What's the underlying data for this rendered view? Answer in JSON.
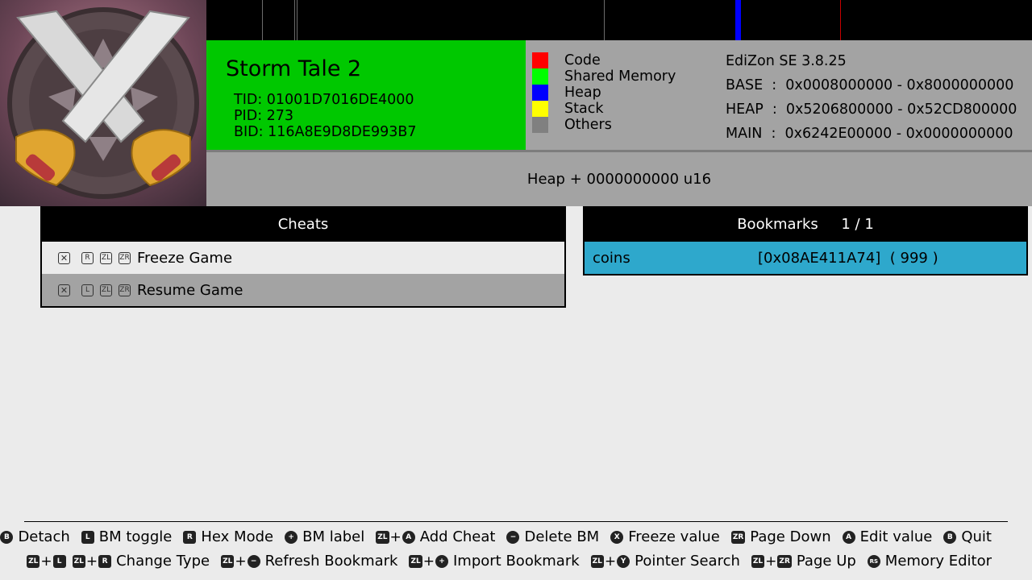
{
  "memory_map": {
    "marks": [
      {
        "color": "#6b6b6b",
        "name": "code-mark"
      },
      {
        "color": "#6b6b6b",
        "name": "code-mark"
      },
      {
        "color": "#6b6b6b",
        "name": "code-mark"
      },
      {
        "color": "#6b6b6b",
        "name": "code-mark"
      },
      {
        "color": "#0000ff",
        "name": "heap-mark"
      },
      {
        "color": "#c80000",
        "name": "code-mark"
      }
    ]
  },
  "game": {
    "title": "Storm Tale 2",
    "tid": "TID: 01001D7016DE4000",
    "pid": "PID: 273",
    "bid": "BID: 116A8E9D8DE993B7"
  },
  "legend": [
    {
      "label": "Code",
      "color": "#ff0000"
    },
    {
      "label": "Shared Memory",
      "color": "#00ff00"
    },
    {
      "label": "Heap",
      "color": "#0000ff"
    },
    {
      "label": "Stack",
      "color": "#ffff00"
    },
    {
      "label": "Others",
      "color": "#808080"
    }
  ],
  "system": {
    "version": "EdiZon SE 3.8.25",
    "base": "BASE  :  0x0008000000 - 0x8000000000",
    "heap": "HEAP  :  0x5206800000 - 0x52CD800000",
    "main": "MAIN  :  0x6242E00000 - 0x0000000000"
  },
  "search": {
    "text": "Heap + 0000000000 u16"
  },
  "cheats": {
    "header": "Cheats",
    "items": [
      {
        "label": "Freeze Game",
        "buttons": [
          "R",
          "ZL",
          "ZR"
        ]
      },
      {
        "label": "Resume Game",
        "buttons": [
          "L",
          "ZL",
          "ZR"
        ]
      }
    ]
  },
  "bookmarks": {
    "header": "Bookmarks     1 / 1",
    "items": [
      {
        "name": "coins",
        "value": "[0x08AE411A74]  ( 999 )"
      }
    ]
  },
  "footer": {
    "row1": [
      {
        "keys": [
          "ZL",
          "+",
          "B"
        ],
        "label": "Detach"
      },
      {
        "keys": [
          "L"
        ],
        "label": "BM toggle"
      },
      {
        "keys": [
          "R"
        ],
        "label": "Hex Mode"
      },
      {
        "keys": [
          "+"
        ],
        "label": "BM label"
      },
      {
        "keys": [
          "ZL",
          "+",
          "A"
        ],
        "label": "Add Cheat"
      },
      {
        "keys": [
          "−"
        ],
        "label": "Delete BM"
      },
      {
        "keys": [
          "X"
        ],
        "label": "Freeze value"
      },
      {
        "keys": [
          "ZR"
        ],
        "label": "Page Down"
      },
      {
        "keys": [
          "A"
        ],
        "label": "Edit value"
      },
      {
        "keys": [
          "B"
        ],
        "label": "Quit"
      }
    ],
    "row2": [
      {
        "keys": [
          "ZL",
          "+",
          "L",
          "ZL",
          "+",
          "R"
        ],
        "label": "Change Type"
      },
      {
        "keys": [
          "ZL",
          "+",
          "−"
        ],
        "label": "Refresh Bookmark"
      },
      {
        "keys": [
          "ZL",
          "+",
          "+"
        ],
        "label": "Import Bookmark"
      },
      {
        "keys": [
          "ZL",
          "+",
          "Y"
        ],
        "label": "Pointer Search"
      },
      {
        "keys": [
          "ZL",
          "+",
          "ZR"
        ],
        "label": "Page Up"
      },
      {
        "keys": [
          "RS"
        ],
        "label": "Memory Editor"
      }
    ]
  }
}
